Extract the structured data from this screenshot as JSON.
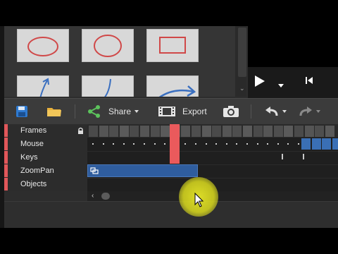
{
  "thumbnails": [
    {
      "shape": "ellipse-red"
    },
    {
      "shape": "circle-red"
    },
    {
      "shape": "rectangle-red"
    },
    {
      "shape": "arrow-blue-up"
    },
    {
      "shape": "arrow-blue-curve"
    },
    {
      "shape": "arrow-blue-right"
    }
  ],
  "toolbar": {
    "share_label": "Share",
    "export_label": "Export"
  },
  "tracks": [
    {
      "label": "Frames",
      "locked": true
    },
    {
      "label": "Mouse",
      "locked": false
    },
    {
      "label": "Keys",
      "locked": false
    },
    {
      "label": "ZoomPan",
      "locked": false
    },
    {
      "label": "Objects",
      "locked": false
    }
  ],
  "colors": {
    "track_accent": "#e2575a",
    "playhead": "#ea5a5c",
    "zoompan_clip": "#2f5d9e",
    "cursor_highlight": "#e6e628"
  },
  "icons": {
    "save": "save-icon",
    "open": "folder-icon",
    "share": "share-icon",
    "export": "film-icon",
    "snapshot": "camera-icon",
    "undo": "undo-icon",
    "redo": "redo-icon",
    "lock": "lock-icon",
    "play": "play-icon",
    "skip": "skip-to-start-icon"
  }
}
